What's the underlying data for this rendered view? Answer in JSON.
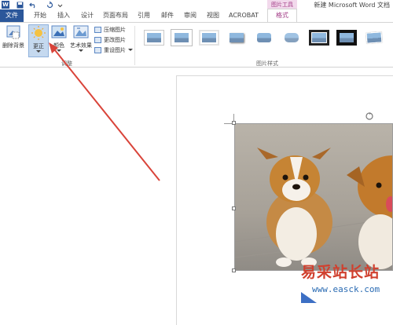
{
  "titlebar": {
    "app_logo": "W",
    "doc_title": "新建 Microsoft Word 文档",
    "context_group": "图片工具"
  },
  "tabs": {
    "file": "文件",
    "items": [
      "开始",
      "插入",
      "设计",
      "页面布局",
      "引用",
      "邮件",
      "审阅",
      "视图",
      "ACROBAT"
    ],
    "format": "格式"
  },
  "ribbon": {
    "remove_bg": "删除背景",
    "corrections": "更正",
    "color": "颜色",
    "artistic": "艺术效果",
    "compress": "压缩图片",
    "change": "更改图片",
    "reset": "重设图片",
    "adjust_group": "调整",
    "styles_group": "图片样式"
  },
  "watermark": {
    "title": "易采站长站",
    "url": "www.easck.com"
  },
  "colors": {
    "word_blue": "#2b579a",
    "context_pink": "#c04b9c",
    "arrow_red": "#d9443a"
  }
}
